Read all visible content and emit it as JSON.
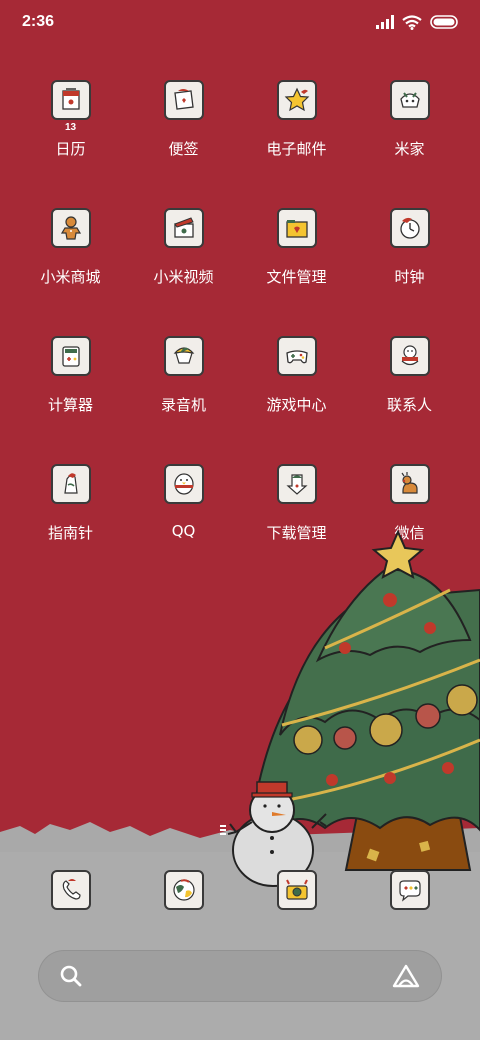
{
  "status_bar": {
    "time": "2:36"
  },
  "apps": [
    {
      "label": "日历",
      "icon": "calendar-icon",
      "badge": "13"
    },
    {
      "label": "便签",
      "icon": "notes-icon"
    },
    {
      "label": "电子邮件",
      "icon": "star-icon"
    },
    {
      "label": "米家",
      "icon": "mihome-icon"
    },
    {
      "label": "小米商城",
      "icon": "gingerbread-icon"
    },
    {
      "label": "小米视频",
      "icon": "video-icon"
    },
    {
      "label": "文件管理",
      "icon": "folder-icon"
    },
    {
      "label": "时钟",
      "icon": "clock-icon"
    },
    {
      "label": "计算器",
      "icon": "calculator-icon"
    },
    {
      "label": "录音机",
      "icon": "recorder-icon"
    },
    {
      "label": "游戏中心",
      "icon": "gamepad-icon"
    },
    {
      "label": "联系人",
      "icon": "snowman-icon"
    },
    {
      "label": "指南针",
      "icon": "compass-icon"
    },
    {
      "label": "QQ",
      "icon": "penguin-icon"
    },
    {
      "label": "下载管理",
      "icon": "download-icon"
    },
    {
      "label": "微信",
      "icon": "reindeer-icon"
    }
  ],
  "dock": [
    {
      "icon": "phone-icon"
    },
    {
      "icon": "browser-icon"
    },
    {
      "icon": "camera-icon"
    },
    {
      "icon": "messages-icon"
    }
  ],
  "colors": {
    "wallpaper": "#a62936",
    "tree": "#3f6b4a",
    "snow": "#a9a9a9"
  }
}
